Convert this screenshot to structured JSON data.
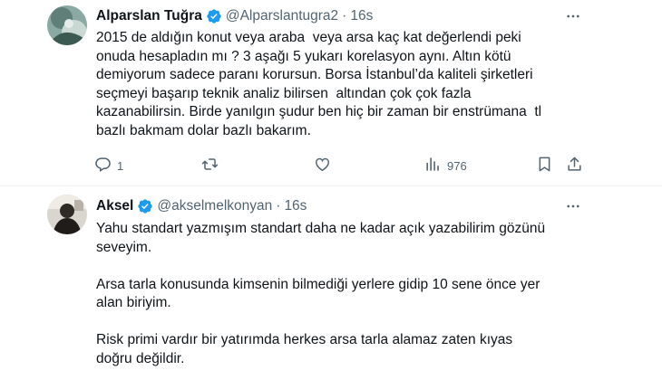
{
  "tweets": [
    {
      "author_name": "Alparslan Tuğra",
      "handle": "@Alparslantugra2",
      "separator": "·",
      "time": "16s",
      "text": "2015 de aldığın konut veya araba  veya arsa kaç kat değerlendi peki onuda hesapladın mı ? 3 aşağı 5 yukarı korelasyon aynı. Altın kötü demiyorum sadece paranı korursun. Borsa İstanbul’da kaliteli şirketleri seçmeyi başarıp teknik analiz bilirsen  altından çok çok fazla kazanabilirsin. Birde yanılgın şudur ben hiç bir zaman bir enstrümana  tl bazlı bakmam dolar bazlı bakarım.",
      "replies": "1",
      "views": "976",
      "icons": {
        "verified": "verified-badge-icon",
        "more": "more-icon"
      }
    },
    {
      "author_name": "Aksel",
      "handle": "@akselmelkonyan",
      "separator": "·",
      "time": "16s",
      "text": "Yahu standart yazmışım standart daha ne kadar açık yazabilirim gözünü seveyim.\n\nArsa tarla konusunda kimsenin bilmediği yerlere gidip 10 sene önce yer alan biriyim.\n\nRisk primi vardır bir yatırımda herkes arsa tarla alamaz zaten kıyas doğru değildir.",
      "icons": {
        "verified": "verified-badge-icon",
        "more": "more-icon"
      }
    }
  ],
  "colors": {
    "verified": "#1d9bf0",
    "secondary_text": "#536471",
    "divider": "#eff3f4"
  },
  "action_icons": [
    "reply-icon",
    "retweet-icon",
    "like-icon",
    "views-icon",
    "bookmark-icon",
    "share-icon"
  ]
}
